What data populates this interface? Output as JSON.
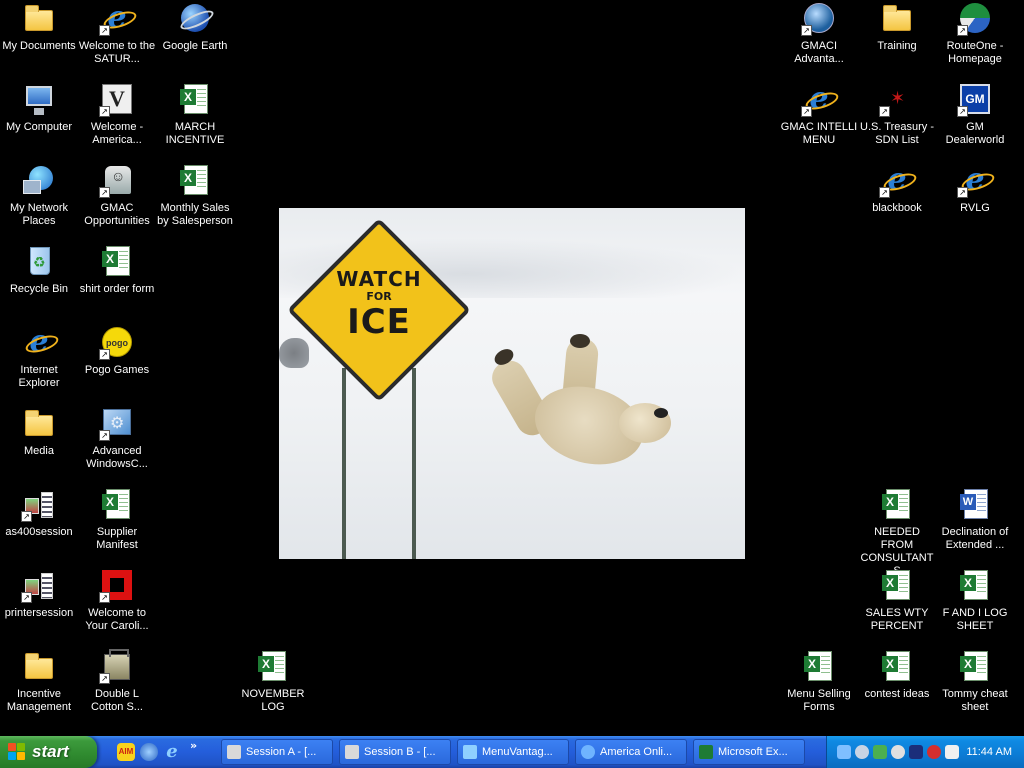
{
  "desktop_icons": {
    "my_documents": "My Documents",
    "welcome_saturn": "Welcome to the SATUR...",
    "google_earth": "Google Earth",
    "my_computer": "My Computer",
    "welcome_america": "Welcome - America...",
    "march_incentive": "MARCH INCENTIVE",
    "my_network_places": "My Network Places",
    "gmac_opportunities": "GMAC Opportunities",
    "monthly_sales": "Monthly Sales by Salesperson",
    "recycle_bin": "Recycle Bin",
    "shirt_order_form": "shirt order form",
    "internet_explorer": "Internet Explorer",
    "pogo_games": "Pogo Games",
    "media": "Media",
    "advanced_windows": "Advanced WindowsC...",
    "as400session": "as400session",
    "supplier_manifest": "Supplier Manifest",
    "printersession": "printersession",
    "welcome_carolina": "Welcome to Your Caroli...",
    "incentive_management": "Incentive Management",
    "double_l_cotton": "Double L Cotton S...",
    "november_log": "NOVEMBER LOG",
    "gmaci_advantage": "GMACI Advanta...",
    "training": "Training",
    "routeone": "RouteOne - Homepage",
    "gmac_intelli_menu": "GMAC INTELLI MENU",
    "us_treasury": "U.S. Treasury - SDN List",
    "gm_dealerworld": "GM Dealerworld",
    "blackbook": "blackbook",
    "rvlg": "RVLG",
    "needed_from_consultants": "NEEDED FROM CONSULTANTS",
    "declination": "Declination of Extended ...",
    "sales_wty_percent": "SALES WTY PERCENT",
    "f_and_i_log": "F AND I LOG SHEET",
    "menu_selling_forms": "Menu Selling Forms",
    "contest_ideas": "contest ideas",
    "tommy_cheat_sheet": "Tommy cheat sheet"
  },
  "wallpaper": {
    "sign_line1": "WATCH",
    "sign_line2": "FOR",
    "sign_line3": "ICE"
  },
  "taskbar": {
    "start_label": "start",
    "quicklaunch_more": "»",
    "buttons": [
      "Session A - [...",
      "Session B - [...",
      "MenuVantag...",
      "America Onli...",
      "Microsoft Ex..."
    ],
    "clock": "11:44 AM"
  },
  "colors": {
    "taskbar_blue": "#245edb",
    "start_green": "#3c9a3c",
    "tray_blue": "#0c7bd4",
    "sign_yellow": "#f2c21a"
  }
}
